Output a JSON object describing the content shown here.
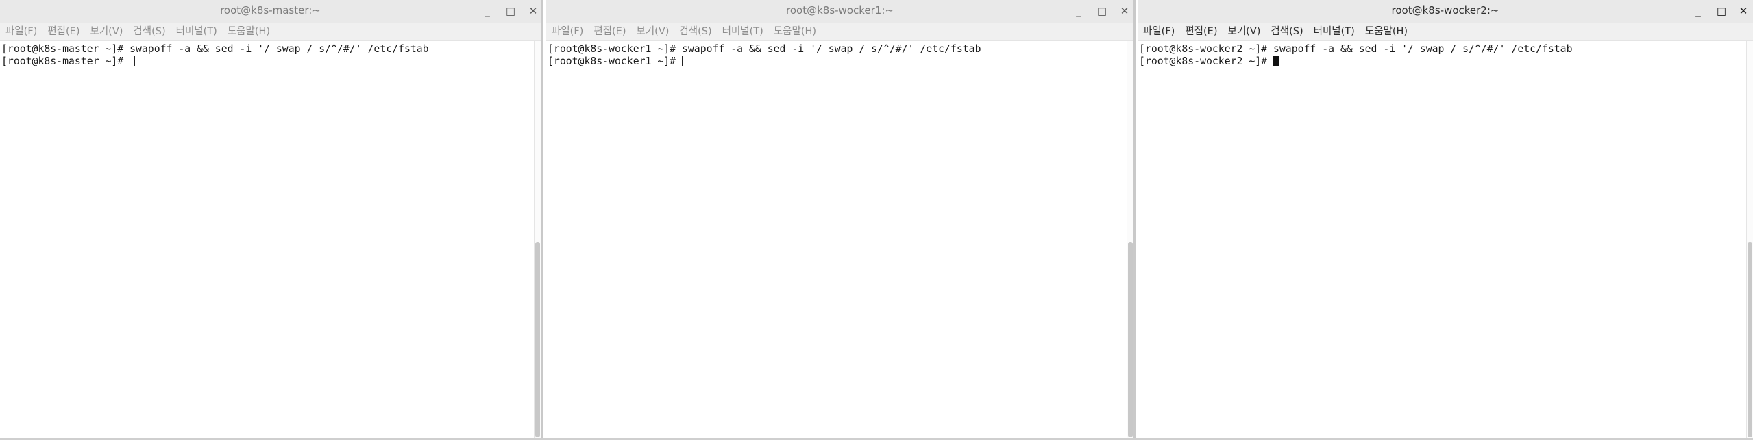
{
  "windows": [
    {
      "title": "root@k8s-master:~",
      "menu": [
        "파일(F)",
        "편집(E)",
        "보기(V)",
        "검색(S)",
        "터미널(T)",
        "도움말(H)"
      ],
      "lines": [
        "[root@k8s-master ~]# swapoff -a && sed -i '/ swap / s/^/#/' /etc/fstab",
        "[root@k8s-master ~]# "
      ],
      "cursor_style": "hollow",
      "active": false
    },
    {
      "title": "root@k8s-wocker1:~",
      "menu": [
        "파일(F)",
        "편집(E)",
        "보기(V)",
        "검색(S)",
        "터미널(T)",
        "도움말(H)"
      ],
      "lines": [
        "[root@k8s-wocker1 ~]# swapoff -a && sed -i '/ swap / s/^/#/' /etc/fstab",
        "[root@k8s-wocker1 ~]# "
      ],
      "cursor_style": "hollow",
      "active": false
    },
    {
      "title": "root@k8s-wocker2:~",
      "menu": [
        "파일(F)",
        "편집(E)",
        "보기(V)",
        "검색(S)",
        "터미널(T)",
        "도움말(H)"
      ],
      "lines": [
        "[root@k8s-wocker2 ~]# swapoff -a && sed -i '/ swap / s/^/#/' /etc/fstab",
        "[root@k8s-wocker2 ~]# "
      ],
      "cursor_style": "block",
      "active": true
    }
  ],
  "window_controls": {
    "minimize": "_",
    "maximize": "□",
    "close": "✕"
  },
  "colors": {
    "titlebar": "#e9e9e9",
    "menubar": "#f0f0f0",
    "terminal_bg": "#ffffff",
    "terminal_fg": "#1a1a1a"
  }
}
